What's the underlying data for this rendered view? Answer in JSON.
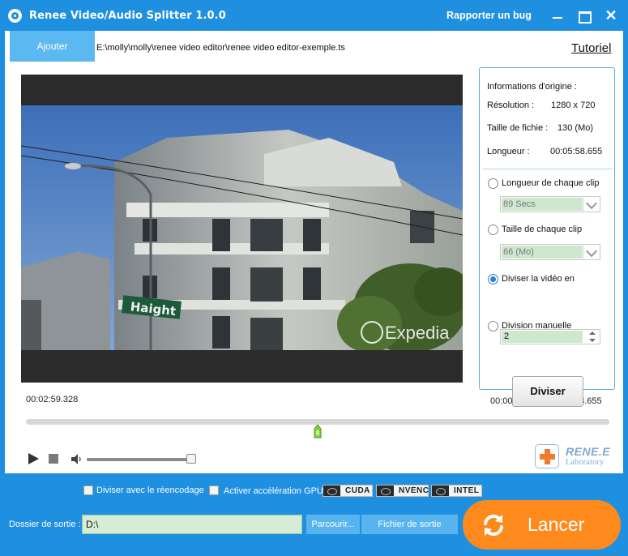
{
  "window": {
    "title": "Renee Video/Audio Splitter 1.0.0",
    "report_bug": "Rapporter un bug"
  },
  "toolbar": {
    "add_label": "Ajouter",
    "file_path": "E:\\molly\\molly\\renee video editor\\renee video editor-exemple.ts",
    "tutorial_label": "Tutoriel"
  },
  "player": {
    "current_time": "00:02:59.328",
    "range_time": "00:00:00.000 / 00:05:58.655",
    "progress_fraction": 0.5,
    "volume_fraction": 0.98,
    "video_watermark": "Expedia",
    "street_sign": "Haight"
  },
  "info": {
    "header": "Informations d'origine :",
    "resolution_label": "Résolution :",
    "resolution_value": "1280 x 720",
    "size_label": "Taille de fichie :",
    "size_value": "130 (Mo)",
    "length_label": "Longueur :",
    "length_value": "00:05:58.655"
  },
  "options": {
    "clip_length_label": "Longueur de chaque clip",
    "clip_length_value": "89 Secs",
    "clip_size_label": "Taille de chaque clip",
    "clip_size_value": "66 (Mo)",
    "divide_label": "Diviser la vidéo en",
    "divide_value": "2",
    "manual_label": "Division manuelle",
    "selected": "divide",
    "split_button": "Diviser"
  },
  "brand": {
    "line1": "RENE.E",
    "line2": "Laboratory"
  },
  "bottom": {
    "reencode_label": "Diviser avec le réencodage",
    "gpu_label": "Activer accélération GPU",
    "gpu_badges": [
      "CUDA",
      "NVENC",
      "INTEL"
    ],
    "output_folder_label": "Dossier de sortie :",
    "output_folder_value": "D:\\",
    "browse_label": "Parcourir...",
    "output_file_label": "Fichier de sortie",
    "launch_label": "Lancer"
  },
  "colors": {
    "accent_blue": "#1f8fe0",
    "button_blue": "#58b4ef",
    "launch_orange": "#fe8a1e",
    "field_green": "#cde8cf"
  }
}
